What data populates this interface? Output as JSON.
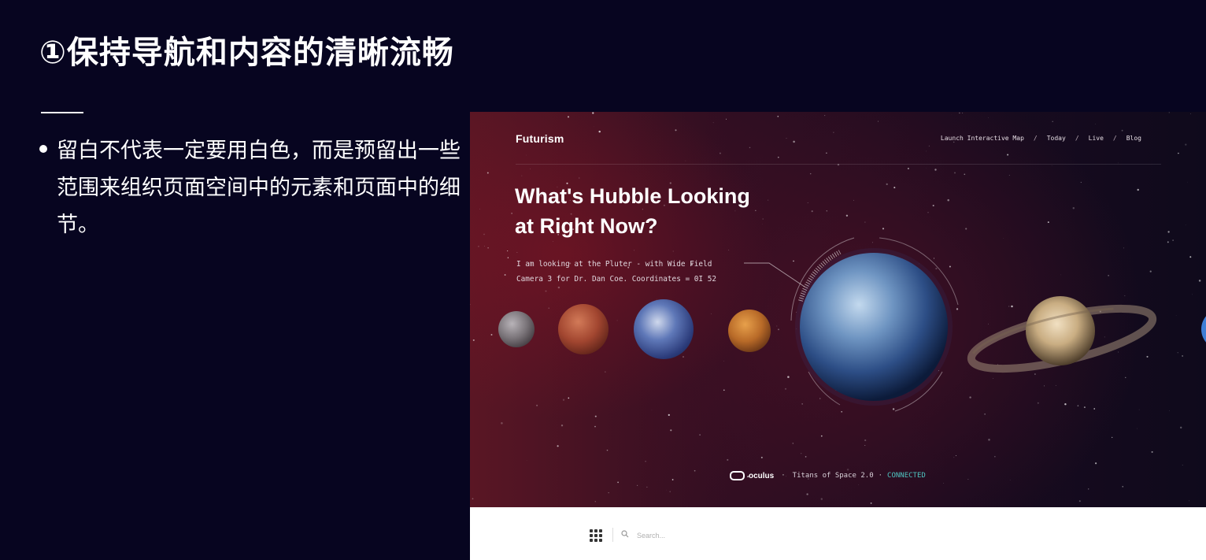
{
  "slide": {
    "title": "①保持导航和内容的清晰流畅",
    "bullet": "留白不代表一定要用白色，而是预留出一些范围来组织页面空间中的元素和页面中的细节。"
  },
  "screenshot": {
    "logo": "Futurism",
    "nav": {
      "items": [
        "Launch Interactive Map",
        "Today",
        "Live",
        "Blog"
      ],
      "separator": "/"
    },
    "hero": {
      "title_line1": "What's Hubble Looking",
      "title_line2": "at Right Now?",
      "desc_line1": "I am looking at the Pluter - with Wide Field",
      "desc_line2": "Camera 3 for Dr. Dan Coe. Coordinates = 0I 52"
    },
    "status": {
      "brand": "oculus",
      "separator": "·",
      "title": "Titans of Space 2.0",
      "state": "CONNECTED",
      "state_color": "#4ec4c0"
    },
    "search": {
      "placeholder": "Search..."
    }
  },
  "icons": [
    "grid-icon",
    "search-icon",
    "oculus-logo-icon"
  ],
  "colors": {
    "slide_background": "#070520",
    "hero_red": "#5a1624",
    "accent_cyan": "#4ec4c0"
  }
}
